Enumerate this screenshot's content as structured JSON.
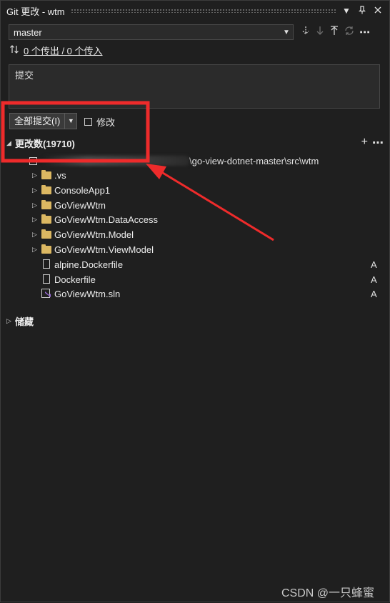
{
  "window": {
    "title": "Git 更改 - wtm",
    "buttons": [
      "dropdown-icon",
      "pin-icon",
      "close-icon"
    ]
  },
  "branch": {
    "selected": "master",
    "actions": [
      "fetch-icon",
      "pull-icon",
      "push-icon",
      "sync-icon",
      "more-icon"
    ]
  },
  "sync_status": {
    "link_text": "0 个传出 / 0 个传入"
  },
  "commit": {
    "placeholder": "提交",
    "commit_all_label": "全部提交(I)",
    "amend_label": "修改"
  },
  "changes": {
    "header": "更改数(19710)",
    "root_path_tail": "\\go-view-dotnet-master\\src\\wtm",
    "items": [
      {
        "name": ".vs",
        "kind": "folder",
        "status": ""
      },
      {
        "name": "ConsoleApp1",
        "kind": "folder",
        "status": ""
      },
      {
        "name": "GoViewWtm",
        "kind": "folder",
        "status": ""
      },
      {
        "name": "GoViewWtm.DataAccess",
        "kind": "folder",
        "status": ""
      },
      {
        "name": "GoViewWtm.Model",
        "kind": "folder",
        "status": ""
      },
      {
        "name": "GoViewWtm.ViewModel",
        "kind": "folder",
        "status": ""
      },
      {
        "name": "alpine.Dockerfile",
        "kind": "file",
        "status": "A"
      },
      {
        "name": "Dockerfile",
        "kind": "file",
        "status": "A"
      },
      {
        "name": "GoViewWtm.sln",
        "kind": "sln",
        "status": "A"
      }
    ]
  },
  "stashes": {
    "header": "储藏"
  },
  "watermark": "CSDN @一只蜂蜜",
  "colors": {
    "background": "#1e1e1e",
    "folder": "#dcb862",
    "annotation": "#ee2b2b",
    "sln_purple": "#9a6bd8"
  }
}
